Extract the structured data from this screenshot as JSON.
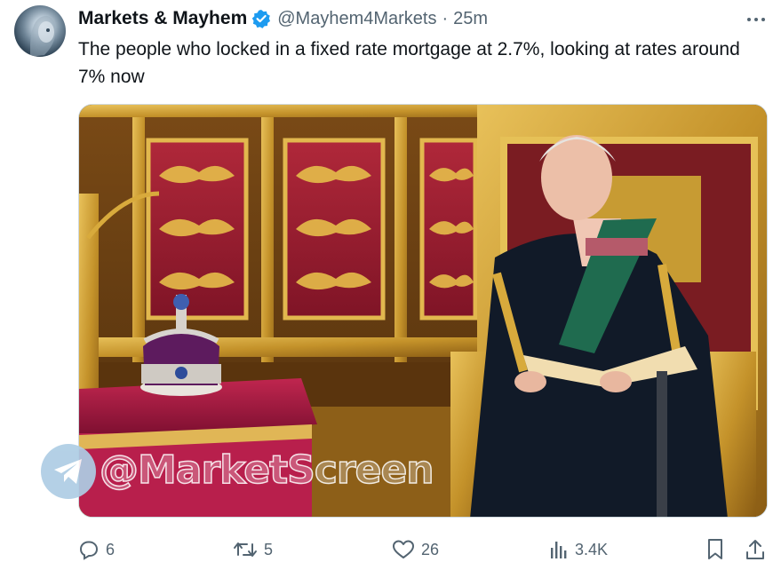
{
  "author": {
    "display_name": "Markets & Mayhem",
    "handle": "@Mayhem4Markets",
    "separator": "·",
    "time": "25m"
  },
  "tweet": {
    "text": "The people who locked in a fixed rate mortgage at 2.7%, looking at rates around 7% now"
  },
  "media": {
    "watermark": "@MarketScreen"
  },
  "actions": {
    "replies": "6",
    "retweets": "5",
    "likes": "26",
    "views": "3.4K"
  },
  "colors": {
    "text_primary": "#0f1419",
    "text_secondary": "#536471",
    "verified_blue": "#1d9bf0",
    "border": "#cfd9de"
  },
  "icons": [
    "avatar",
    "verified-badge-icon",
    "more-icon",
    "reply-icon",
    "retweet-icon",
    "like-icon",
    "views-icon",
    "bookmark-icon",
    "share-icon",
    "telegram-icon"
  ]
}
